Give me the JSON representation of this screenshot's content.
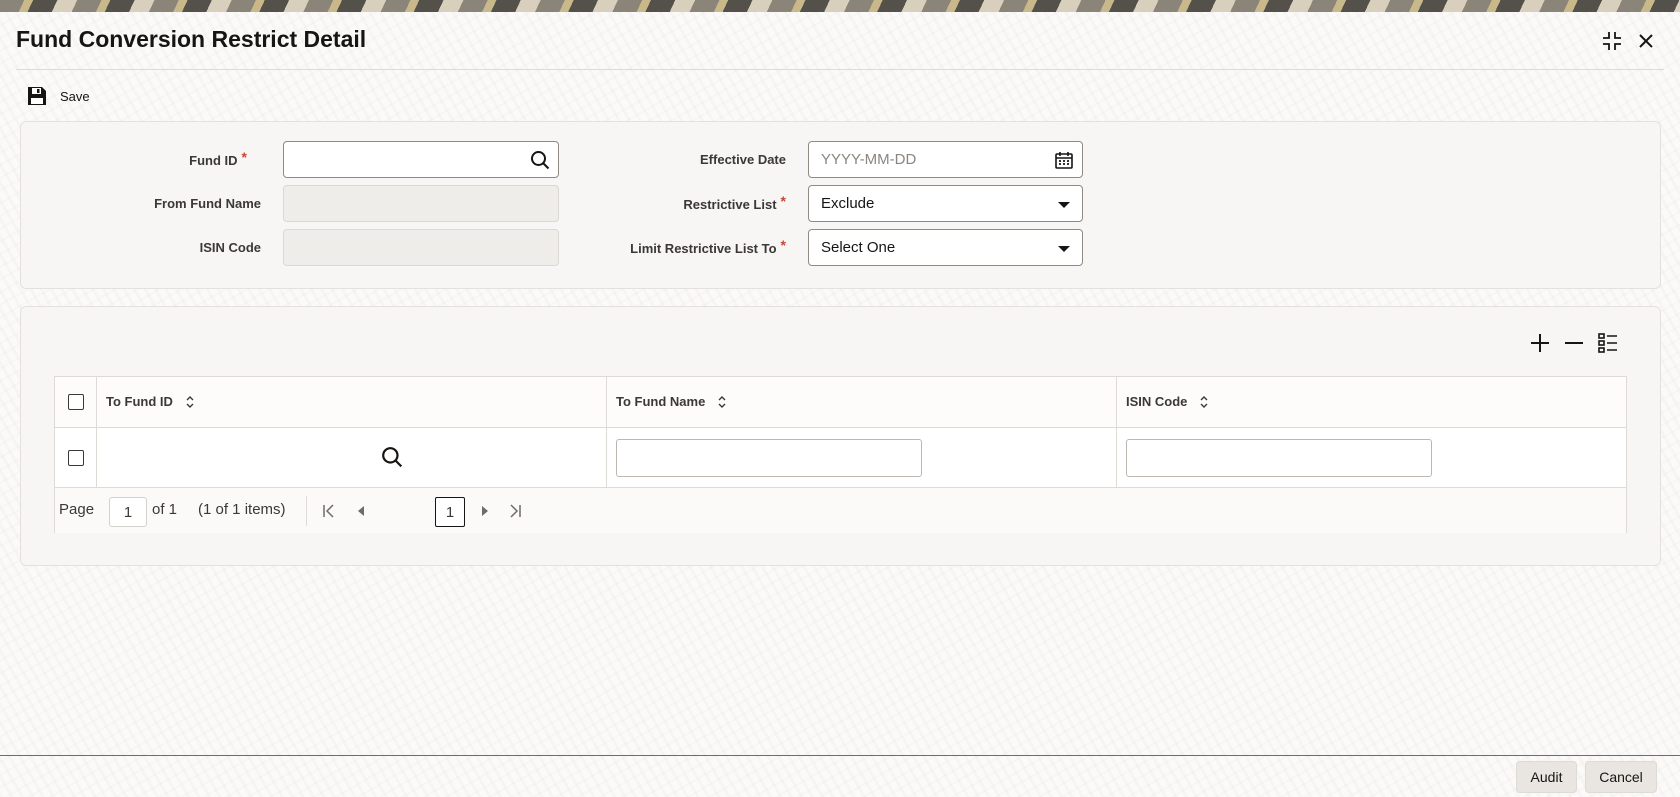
{
  "window": {
    "title": "Fund Conversion Restrict Detail"
  },
  "toolbar": {
    "save_label": "Save"
  },
  "form": {
    "fund_id": {
      "label": "Fund ID",
      "value": ""
    },
    "from_fund_name": {
      "label": "From Fund Name",
      "value": ""
    },
    "isin_code": {
      "label": "ISIN Code",
      "value": ""
    },
    "effective_date": {
      "label": "Effective Date",
      "placeholder": "YYYY-MM-DD",
      "value": ""
    },
    "restrictive_list": {
      "label": "Restrictive List",
      "value": "Exclude"
    },
    "limit_restrictive_list_to": {
      "label": "Limit Restrictive List To",
      "value": "Select One"
    },
    "required_marker": "*"
  },
  "grid": {
    "columns": [
      "To Fund ID",
      "To Fund Name",
      "ISIN Code"
    ],
    "rows": [
      {
        "to_fund_id": "",
        "to_fund_name": "",
        "isin_code": ""
      }
    ],
    "pagination": {
      "page_label": "Page",
      "page_value": "1",
      "of_text": "of 1",
      "items_text": "(1 of 1 items)",
      "current_page": "1"
    }
  },
  "footer": {
    "audit_label": "Audit",
    "cancel_label": "Cancel"
  },
  "icons": {
    "maximize": "maximize-icon",
    "close": "close-icon",
    "save": "floppy-disk-icon",
    "search": "search-icon",
    "calendar": "calendar-icon",
    "dropdown": "chevron-down-icon",
    "add": "plus-icon",
    "remove": "minus-icon",
    "columns": "list-columns-icon",
    "sort": "sort-icon"
  }
}
